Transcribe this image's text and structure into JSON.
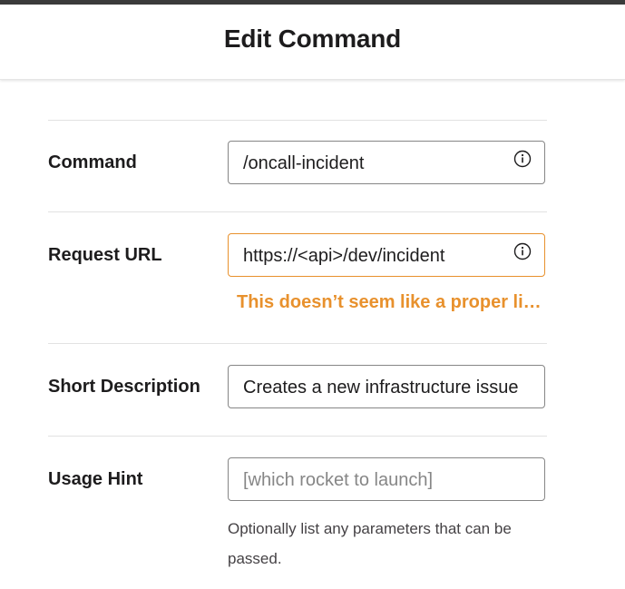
{
  "header": {
    "title": "Edit Command"
  },
  "form": {
    "command": {
      "label": "Command",
      "value": "/oncall-incident",
      "icon": "info-icon"
    },
    "request_url": {
      "label": "Request URL",
      "value": "https://<api>/dev/incident",
      "icon": "info-icon",
      "error": "This doesn’t seem like a proper link. Sorry!"
    },
    "short_description": {
      "label": "Short Description",
      "value": "Creates a new infrastructure issue"
    },
    "usage_hint": {
      "label": "Usage Hint",
      "placeholder": "[which rocket to launch]",
      "help": "Optionally list any parameters that can be passed."
    }
  },
  "colors": {
    "warning": "#e8912d",
    "input_border": "#868686",
    "divider": "#e2e2e2",
    "top_strip": "#3b3b3b"
  }
}
